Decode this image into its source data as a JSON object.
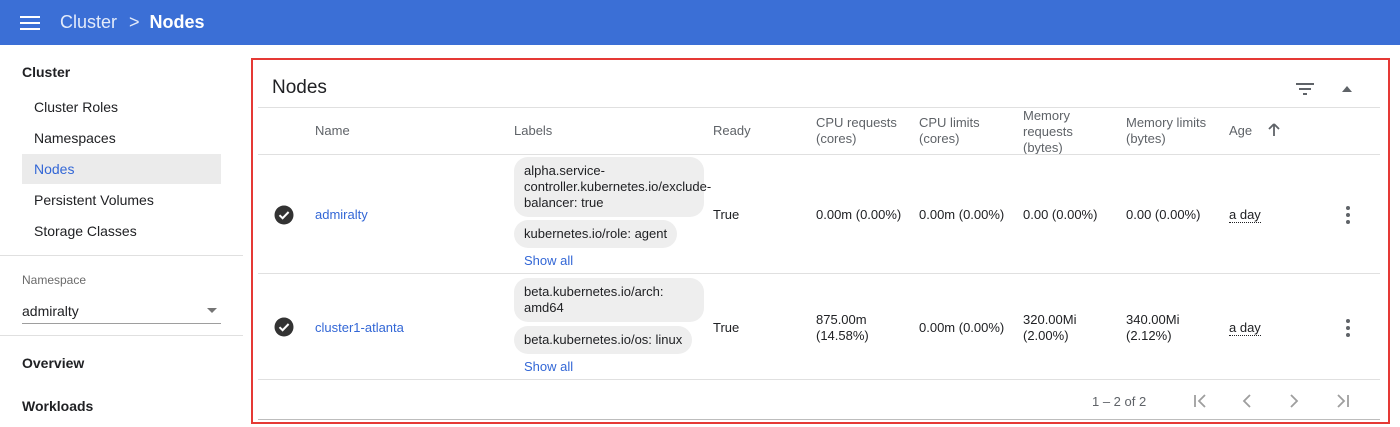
{
  "header": {
    "menu_icon": "hamburger-menu-icon",
    "breadcrumb_parent": "Cluster",
    "breadcrumb_separator": ">",
    "breadcrumb_current": "Nodes",
    "bar_color": "#3b6fd6"
  },
  "sidebar": {
    "section_title": "Cluster",
    "items": [
      {
        "label": "Cluster Roles",
        "active": false
      },
      {
        "label": "Namespaces",
        "active": false
      },
      {
        "label": "Nodes",
        "active": true
      },
      {
        "label": "Persistent Volumes",
        "active": false
      },
      {
        "label": "Storage Classes",
        "active": false
      }
    ],
    "namespace_label": "Namespace",
    "namespace_value": "admiralty",
    "overview_label": "Overview",
    "workloads_label": "Workloads"
  },
  "card": {
    "title": "Nodes",
    "filter_icon": "filter-icon",
    "collapse_icon": "chevron-up-icon",
    "columns": {
      "name": "Name",
      "labels": "Labels",
      "ready": "Ready",
      "cpu_requests": "CPU requests (cores)",
      "cpu_limits": "CPU limits (cores)",
      "memory_requests": "Memory requests (bytes)",
      "memory_limits": "Memory limits (bytes)",
      "age": "Age"
    },
    "sort": {
      "column": "Age",
      "direction": "ascending"
    },
    "rows": [
      {
        "status_icon": "check-circle-icon",
        "name": "admiralty",
        "labels": [
          "alpha.service-controller.kubernetes.io/exclude-balancer: true",
          "kubernetes.io/role: agent"
        ],
        "show_all": "Show all",
        "ready": "True",
        "cpu_requests": "0.00m (0.00%)",
        "cpu_limits": "0.00m (0.00%)",
        "memory_requests": "0.00 (0.00%)",
        "memory_limits": "0.00 (0.00%)",
        "age": "a day"
      },
      {
        "status_icon": "check-circle-icon",
        "name": "cluster1-atlanta",
        "labels": [
          "beta.kubernetes.io/arch: amd64",
          "beta.kubernetes.io/os: linux"
        ],
        "show_all": "Show all",
        "ready": "True",
        "cpu_requests": "875.00m (14.58%)",
        "cpu_limits": "0.00m (0.00%)",
        "memory_requests": "320.00Mi (2.00%)",
        "memory_limits": "340.00Mi (2.12%)",
        "age": "a day"
      }
    ],
    "pagination": {
      "range": "1 – 2 of 2",
      "icons": [
        "first-page-icon",
        "previous-page-icon",
        "next-page-icon",
        "last-page-icon"
      ]
    }
  },
  "highlight_color": "#e53935",
  "link_color": "#3367d6"
}
